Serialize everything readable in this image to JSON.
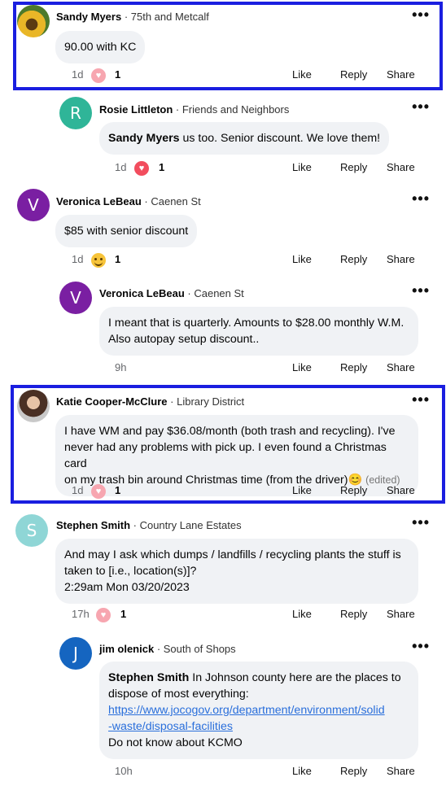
{
  "ui": {
    "more_glyph": "•••",
    "like_label": "Like",
    "reply_label": "Reply",
    "share_label": "Share",
    "separator": " · "
  },
  "colors": {
    "highlight": "#1a1ee0",
    "bubble": "#f0f2f5",
    "link": "#2a6fdb"
  },
  "comments": [
    {
      "author": "Sandy Myers",
      "location": "75th and Metcalf",
      "avatar": "sunflower-photo",
      "text": "90.00 with KC",
      "time": "1d",
      "reaction": "heart",
      "reaction_count": "1"
    },
    {
      "author": "Rosie Littleton",
      "location": "Friends and Neighbors",
      "avatar_letter": "R",
      "avatar_color": "#2fb598",
      "mention": "Sandy Myers",
      "text": "us too. Senior discount. We love them!",
      "time": "1d",
      "reaction": "heart",
      "reaction_count": "1"
    },
    {
      "author": "Veronica LeBeau",
      "location": "Caenen St",
      "avatar_letter": "V",
      "avatar_color": "#7a1fa2",
      "text": "$85 with senior discount",
      "time": "1d",
      "reaction": "laugh",
      "reaction_count": "1"
    },
    {
      "author": "Veronica LeBeau",
      "location": "Caenen St",
      "avatar_letter": "V",
      "avatar_color": "#7a1fa2",
      "text_lines": [
        "I meant  that is quarterly. Amounts to $28.00 monthly W.M.",
        "Also autopay setup discount.."
      ],
      "time": "9h"
    },
    {
      "author": "Katie Cooper-McClure",
      "location": "Library District",
      "avatar": "portrait-photo",
      "text_lines": [
        "I have WM and pay $36.08/month (both trash and recycling). I've",
        "never had any problems with pick up. I even found a Christmas card",
        "on my trash bin around Christmas time (from the driver)😊"
      ],
      "edited": "(edited)",
      "time": "1d",
      "reaction": "heart",
      "reaction_count": "1"
    },
    {
      "author": "Stephen Smith",
      "location": "Country Lane Estates",
      "avatar_letter": "S",
      "avatar_color": "#8fd6d6",
      "text_lines": [
        "And may I ask which dumps / landfills / recycling plants the stuff is",
        "taken to [i.e., location(s)]?",
        "2:29am Mon 03/20/2023"
      ],
      "time": "17h",
      "reaction": "heart",
      "reaction_count": "1"
    },
    {
      "author": "jim olenick",
      "location": "South of Shops",
      "avatar_letter": "J",
      "avatar_color": "#1565c0",
      "mention": "Stephen Smith",
      "text_first": "In Johnson county here are the places to",
      "text_second": "dispose of most everything:",
      "link_lines": [
        "https://www.jocogov.org/department/environment/solid",
        "-waste/disposal-facilities"
      ],
      "text_last": "Do not know about KCMO",
      "time": "10h"
    }
  ]
}
